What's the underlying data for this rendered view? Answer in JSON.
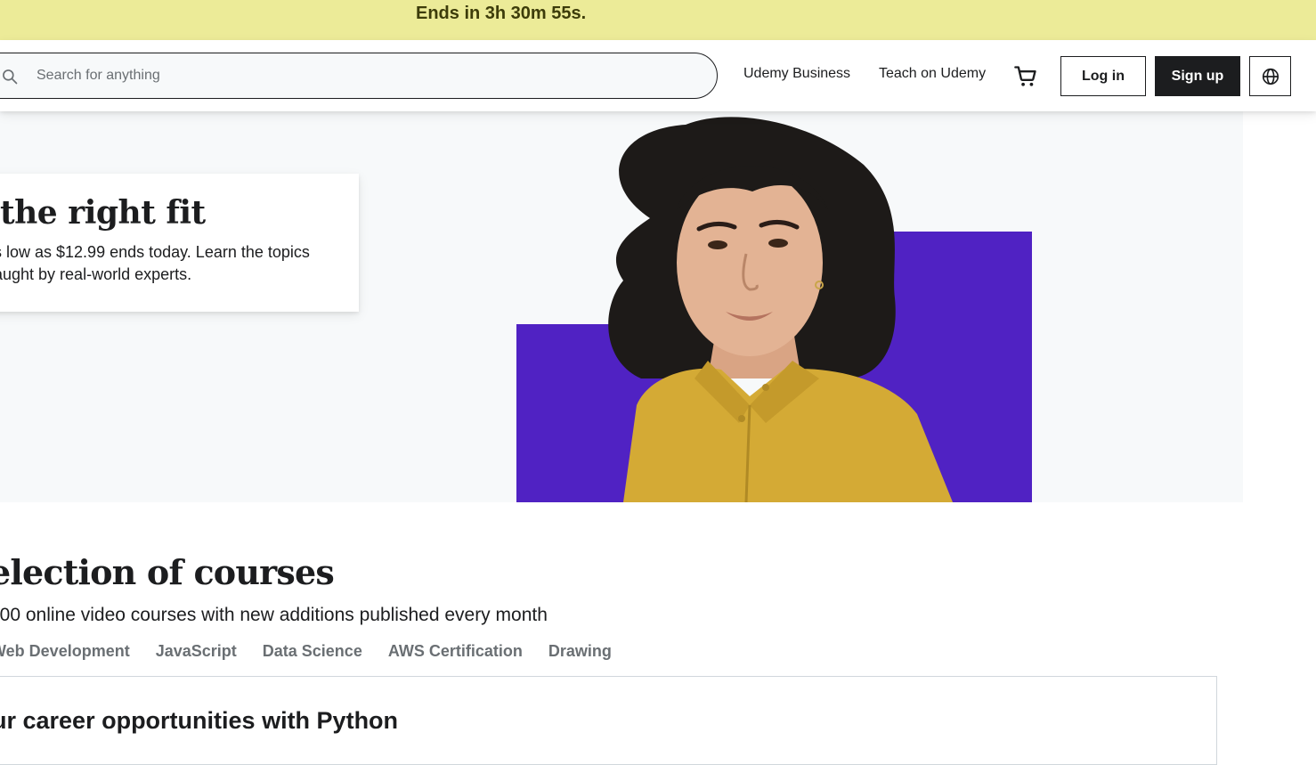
{
  "promo": {
    "countdown_text": "Ends in 3h 30m 55s."
  },
  "header": {
    "search_placeholder": "Search for anything",
    "nav": {
      "business": "Udemy Business",
      "teach": "Teach on Udemy"
    },
    "login_label": "Log in",
    "signup_label": "Sign up",
    "icons": {
      "search": "search-icon",
      "cart": "cart-icon",
      "language": "globe-icon"
    }
  },
  "hero": {
    "title": "the right fit",
    "subtitle": "s low as $12.99 ends today. Learn the topics\naught by real-world experts."
  },
  "courses": {
    "heading": "election of courses",
    "subheading": "000 online video courses with new additions published every month",
    "tabs": [
      "Web Development",
      "JavaScript",
      "Data Science",
      "AWS Certification",
      "Drawing"
    ],
    "featured_title": "ur career opportunities with Python"
  },
  "colors": {
    "promo_bg": "#eceb98",
    "hero_bg": "#f7f9fa",
    "accent_purple": "#5022c3",
    "shirt_mustard": "#d4aa35",
    "text_primary": "#1c1d1f",
    "text_muted": "#6a6f73"
  }
}
